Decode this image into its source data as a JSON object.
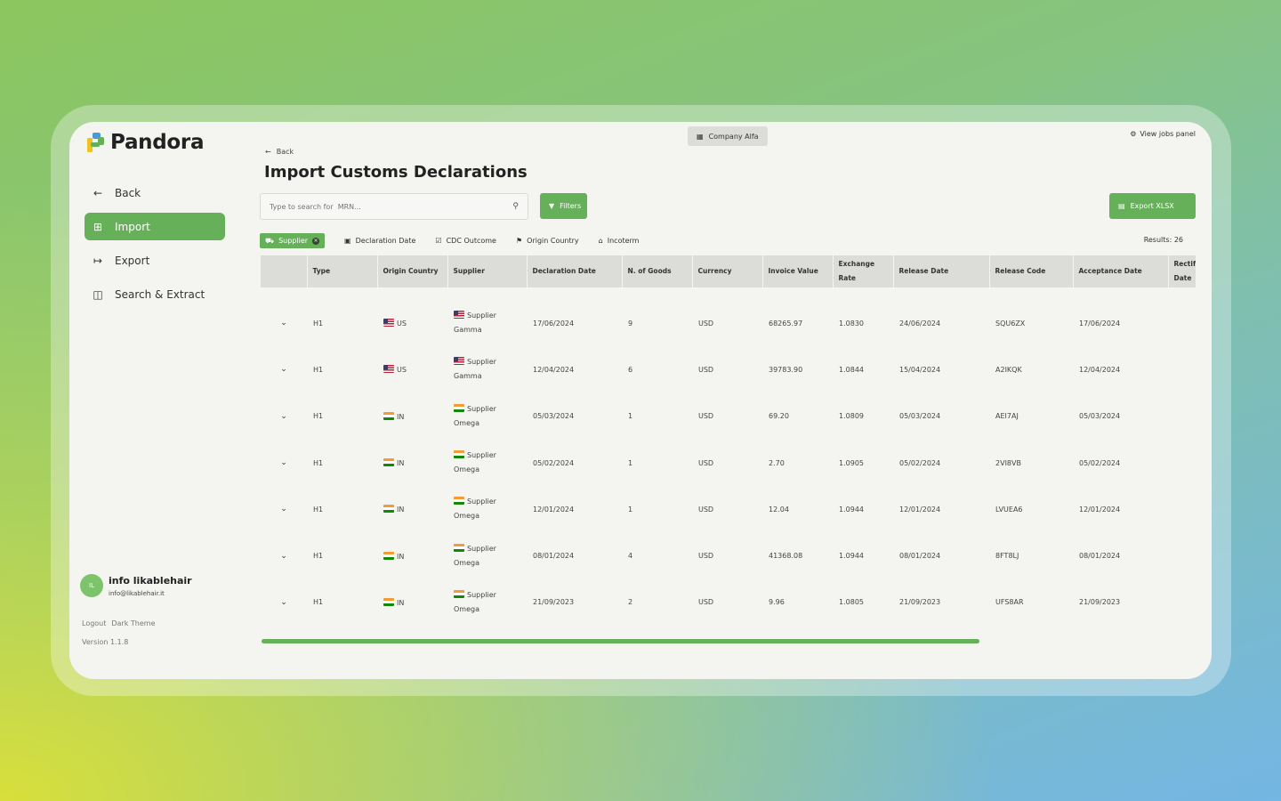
{
  "app": {
    "name": "Pandora"
  },
  "sidebar": {
    "items": [
      {
        "label": "Back",
        "icon": "arrow-left-icon"
      },
      {
        "label": "Import",
        "icon": "import-icon",
        "active": true
      },
      {
        "label": "Export",
        "icon": "export-icon"
      },
      {
        "label": "Search & Extract",
        "icon": "search-extract-icon"
      }
    ],
    "user": {
      "initials": "IL",
      "name": "info likablehair",
      "email": "info@likablehair.it"
    },
    "logout": "Logout",
    "theme": "Dark Theme",
    "version": "Version 1.1.8"
  },
  "header": {
    "company": "Company Alfa",
    "jobs_panel": "View jobs panel",
    "back": "Back",
    "title": "Import Customs Declarations"
  },
  "toolbar": {
    "search_placeholder": "Type to search for  MRN...",
    "filters_label": "Filters",
    "export_label": "Export XLSX"
  },
  "chips": {
    "active": "Supplier",
    "items": [
      "Declaration Date",
      "CDC Outcome",
      "Origin Country",
      "Incoterm"
    ]
  },
  "results": "Results: 26",
  "colors": {
    "accent": "#66b05a",
    "header_bg": "#dcdcd8"
  },
  "table": {
    "headers": [
      "Type",
      "Origin Country",
      "Supplier",
      "Declaration Date",
      "N. of Goods",
      "Currency",
      "Invoice Value",
      "Exchange Rate",
      "Release Date",
      "Release Code",
      "Acceptance Date",
      "Rectif. Date"
    ],
    "rows": [
      {
        "type": "H1",
        "country": "US",
        "flag": "us",
        "supplier1": "Supplier",
        "supplier2": "Gamma",
        "decl": "17/06/2024",
        "goods": "9",
        "currency": "USD",
        "invoice": "68265.97",
        "rate": "1.0830",
        "release": "24/06/2024",
        "code": "SQU6ZX",
        "accept": "17/06/2024"
      },
      {
        "type": "H1",
        "country": "US",
        "flag": "us",
        "supplier1": "Supplier",
        "supplier2": "Gamma",
        "decl": "12/04/2024",
        "goods": "6",
        "currency": "USD",
        "invoice": "39783.90",
        "rate": "1.0844",
        "release": "15/04/2024",
        "code": "A2IKQK",
        "accept": "12/04/2024"
      },
      {
        "type": "H1",
        "country": "IN",
        "flag": "in",
        "supplier1": "Supplier",
        "supplier2": "Omega",
        "decl": "05/03/2024",
        "goods": "1",
        "currency": "USD",
        "invoice": "69.20",
        "rate": "1.0809",
        "release": "05/03/2024",
        "code": "AEI7AJ",
        "accept": "05/03/2024"
      },
      {
        "type": "H1",
        "country": "IN",
        "flag": "in",
        "supplier1": "Supplier",
        "supplier2": "Omega",
        "decl": "05/02/2024",
        "goods": "1",
        "currency": "USD",
        "invoice": "2.70",
        "rate": "1.0905",
        "release": "05/02/2024",
        "code": "2VI8VB",
        "accept": "05/02/2024"
      },
      {
        "type": "H1",
        "country": "IN",
        "flag": "in",
        "supplier1": "Supplier",
        "supplier2": "Omega",
        "decl": "12/01/2024",
        "goods": "1",
        "currency": "USD",
        "invoice": "12.04",
        "rate": "1.0944",
        "release": "12/01/2024",
        "code": "LVUEA6",
        "accept": "12/01/2024"
      },
      {
        "type": "H1",
        "country": "IN",
        "flag": "in",
        "supplier1": "Supplier",
        "supplier2": "Omega",
        "decl": "08/01/2024",
        "goods": "4",
        "currency": "USD",
        "invoice": "41368.08",
        "rate": "1.0944",
        "release": "08/01/2024",
        "code": "8FT8LJ",
        "accept": "08/01/2024"
      },
      {
        "type": "H1",
        "country": "IN",
        "flag": "in",
        "supplier1": "Supplier",
        "supplier2": "Omega",
        "decl": "21/09/2023",
        "goods": "2",
        "currency": "USD",
        "invoice": "9.96",
        "rate": "1.0805",
        "release": "21/09/2023",
        "code": "UFS8AR",
        "accept": "21/09/2023"
      }
    ]
  }
}
